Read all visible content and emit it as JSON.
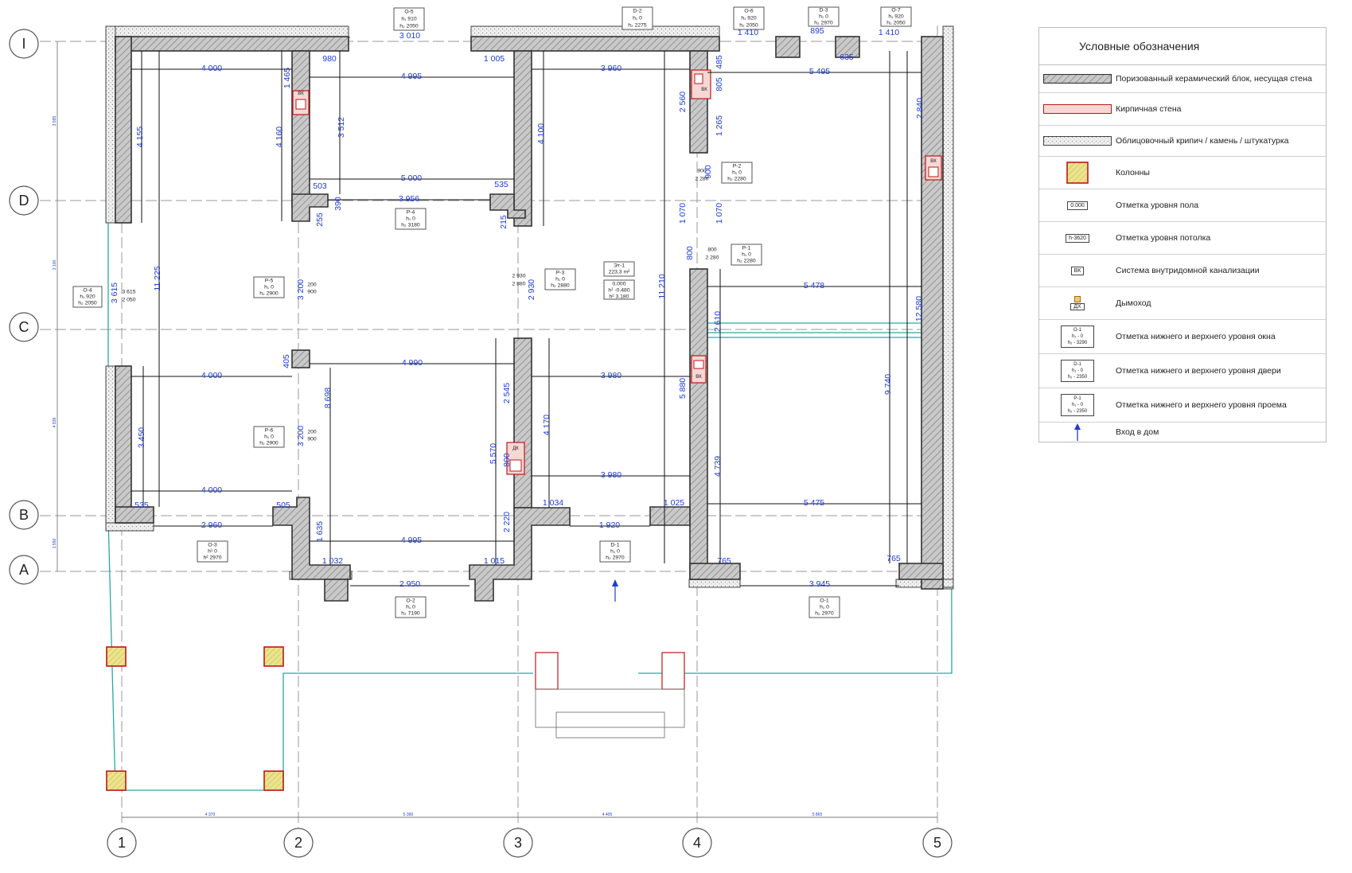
{
  "axes": {
    "horizontal": [
      "I",
      "D",
      "C",
      "B",
      "A"
    ],
    "vertical": [
      "1",
      "2",
      "3",
      "4",
      "5"
    ]
  },
  "room": {
    "name": "Эт-1",
    "area": "223,3 m²",
    "floor_mark": "0.000",
    "h1": "h¹ -0.480",
    "h2": "h² 3.180"
  },
  "dims_h": [
    "3 010",
    "1 410",
    "895",
    "1 410",
    "635",
    "980",
    "1 005",
    "4 000",
    "4 995",
    "3 960",
    "5 495",
    "5 000",
    "503",
    "535",
    "3 956",
    "5 478",
    "4 000",
    "4 990",
    "3 980",
    "4 000",
    "3 980",
    "5 475",
    "535",
    "505",
    "1 034",
    "1 025",
    "2 960",
    "1 920",
    "4 995",
    "1 032",
    "1 015",
    "765",
    "765",
    "2 950",
    "3 945"
  ],
  "dims_v": [
    "1 465",
    "3 512",
    "4 160",
    "4 155",
    "11 225",
    "4 100",
    "2 560",
    "805",
    "485",
    "1 265",
    "900",
    "1 070",
    "1 070",
    "800",
    "2 840",
    "3 615",
    "390",
    "255",
    "215",
    "2 930",
    "3 200",
    "11 210",
    "12 580",
    "2 610",
    "405",
    "8 698",
    "2 545",
    "4 170",
    "800",
    "5 570",
    "3 450",
    "3 200",
    "5 880",
    "4 739",
    "9 740",
    "2 220",
    "1 635"
  ],
  "tags": {
    "O5": [
      "О-5",
      "h₁ 910",
      "h₂ 2050"
    ],
    "D2": [
      "D-2",
      "h₁ 0",
      "h₂ 2275"
    ],
    "O6": [
      "О-6",
      "h₁ 920",
      "h₂ 2050"
    ],
    "D3": [
      "D-3",
      "h₁ 0",
      "h₂ 2970"
    ],
    "O7": [
      "О-7",
      "h₁ 920",
      "h₂ 2050"
    ],
    "P2": [
      "Р-2",
      "h₁ 0",
      "h₂ 2280"
    ],
    "P4": [
      "Р-4",
      "h₁ 0",
      "h₂ 3180"
    ],
    "P1": [
      "Р-1",
      "h₁ 0",
      "h₂ 2280"
    ],
    "P3": [
      "Р-3",
      "h₁ 0",
      "h₂ 2880"
    ],
    "P5": [
      "Р-5",
      "h₁ 0",
      "h₂ 2900"
    ],
    "O4": [
      "О-4",
      "h₁ 920",
      "h₂ 2050"
    ],
    "P6": [
      "Р-6",
      "h₁ 0",
      "h₂ 2900"
    ],
    "O3": [
      "О-3",
      "h¹ 0",
      "h² 2970"
    ],
    "D1": [
      "D-1",
      "h₁ 0",
      "h₂ 2970"
    ],
    "O2": [
      "О-2",
      "h₁ 0",
      "h₂ 7190"
    ],
    "O1": [
      "О-1",
      "h₁ 0",
      "h₂ 2970"
    ]
  },
  "small_marks": {
    "vk": "ВК",
    "bk": "ВК",
    "dk": "ДК",
    "o4_w": "3 615",
    "o4_h": "2 050",
    "p3_w": "2 930",
    "p3_h": "2 880",
    "p2_w": "900",
    "p2_h": "2 280",
    "p1_w": "800",
    "p1_h": "2 280",
    "p5_w": "200",
    "p5_h": "900",
    "p6_w": "200",
    "p6_h": "900"
  },
  "bottom_dims": [
    "4 370",
    "5 390",
    "4 405",
    "5 865"
  ],
  "left_dims": [
    "3 995",
    "3 100",
    "4 939",
    "1 550"
  ],
  "legend": {
    "title": "Условные обозначения",
    "items": [
      {
        "label": "Поризованный керамический блок, несущая стена"
      },
      {
        "label": "Кирпичная стена"
      },
      {
        "label": "Облицовочный крипич / камень / штукатурка"
      },
      {
        "label": "Колонны"
      },
      {
        "label": "Отметка уровня пола",
        "symbol": "0.000"
      },
      {
        "label": "Отметка уровня потолка",
        "symbol": "h-3620"
      },
      {
        "label": "Система внутридомной канализации",
        "symbol": "ВК"
      },
      {
        "label": "Дымоход",
        "symbol": "ДХ"
      },
      {
        "label": "Отметка нижнего и верхнего уровня окна",
        "symbol": [
          "О-1",
          "h₁ - 0",
          "h₂ - 3290"
        ]
      },
      {
        "label": "Отметка нижнего и верхнего уровня двери",
        "symbol": [
          "D-1",
          "h₁ - 0",
          "h₂ - 2350"
        ]
      },
      {
        "label": "Отметка нижнего и верхнего уровня проема",
        "symbol": [
          "Р-1",
          "h₁ - 0",
          "h₂ - 2350"
        ]
      },
      {
        "label": "Вход в дом"
      }
    ]
  },
  "colors": {
    "dimension_text": "#1f3bd6",
    "teal_outline": "#2aa9a1",
    "column_red": "#c01616",
    "column_fill": "#e8df7a"
  }
}
